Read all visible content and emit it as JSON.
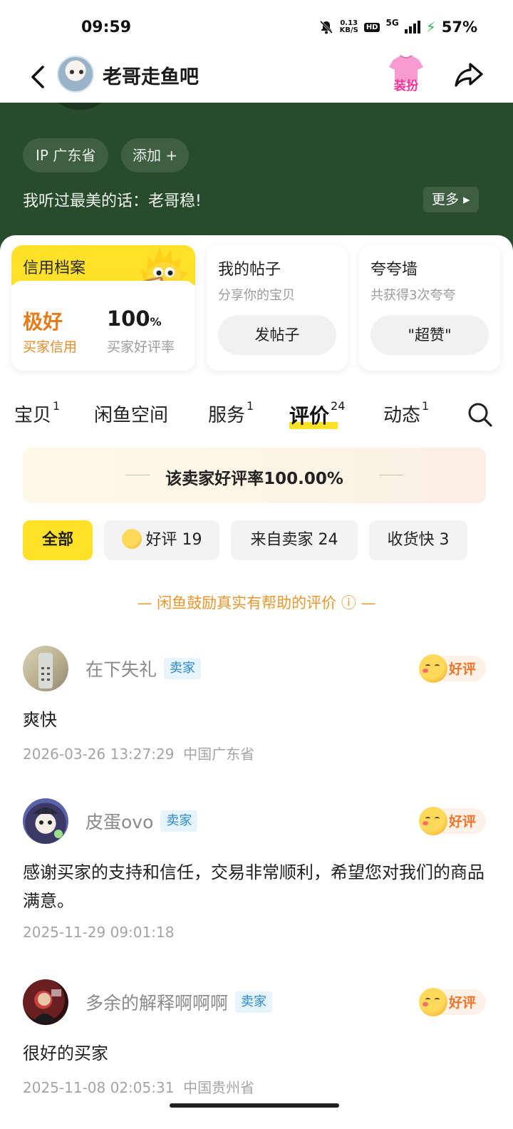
{
  "status": {
    "time": "09:59",
    "net_speed_top": "0.13",
    "net_speed_bottom": "KB/S",
    "hd": "HD",
    "network": "5G",
    "battery": "57%"
  },
  "nav": {
    "title": "老哥走鱼吧",
    "dress_label": "装扮"
  },
  "profile": {
    "ip": "IP 广东省",
    "add": "添加 +",
    "bio": "我听过最美的话：老哥稳!",
    "more": "更多 ▸"
  },
  "cards": {
    "credit_title": "信用档案",
    "credit_level": "极好",
    "credit_level_sub": "买家信用",
    "good_rate": "100",
    "good_rate_unit": "%",
    "good_rate_sub": "买家好评率",
    "posts_title": "我的帖子",
    "posts_sub": "分享你的宝贝",
    "posts_button": "发帖子",
    "wall_title": "夸夸墙",
    "wall_sub": "共获得3次夸夸",
    "wall_button": "\"超赞\""
  },
  "tabs": [
    {
      "label": "宝贝",
      "count": "1"
    },
    {
      "label": "闲鱼空间",
      "count": ""
    },
    {
      "label": "服务",
      "count": "1"
    },
    {
      "label": "评价",
      "count": "24"
    },
    {
      "label": "动态",
      "count": "1"
    }
  ],
  "rating_banner": "该卖家好评率100.00%",
  "filters": [
    {
      "label": "全部"
    },
    {
      "label": "好评 19"
    },
    {
      "label": "来自卖家 24"
    },
    {
      "label": "收货快 3"
    }
  ],
  "encourage": "— 闲鱼鼓励真实有帮助的评价 ⓘ —",
  "reviews": [
    {
      "name": "在下失礼",
      "tag": "卖家",
      "badge": "好评",
      "content": "爽快",
      "time": "2026-03-26 13:27:29",
      "location": "中国广东省"
    },
    {
      "name": "皮蛋ovo",
      "tag": "卖家",
      "badge": "好评",
      "content": "感谢买家的支持和信任，交易非常顺利，希望您对我们的商品满意。",
      "time": "2025-11-29 09:01:18",
      "location": ""
    },
    {
      "name": "多余的解释啊啊啊",
      "tag": "卖家",
      "badge": "好评",
      "content": "很好的买家",
      "time": "2025-11-08 02:05:31",
      "location": "中国贵州省"
    }
  ],
  "colors": {
    "accent_yellow": "#ffe12a",
    "header_green": "#284a2d",
    "good_orange": "#f0742a",
    "seller_blue": "#2a8ad8"
  }
}
